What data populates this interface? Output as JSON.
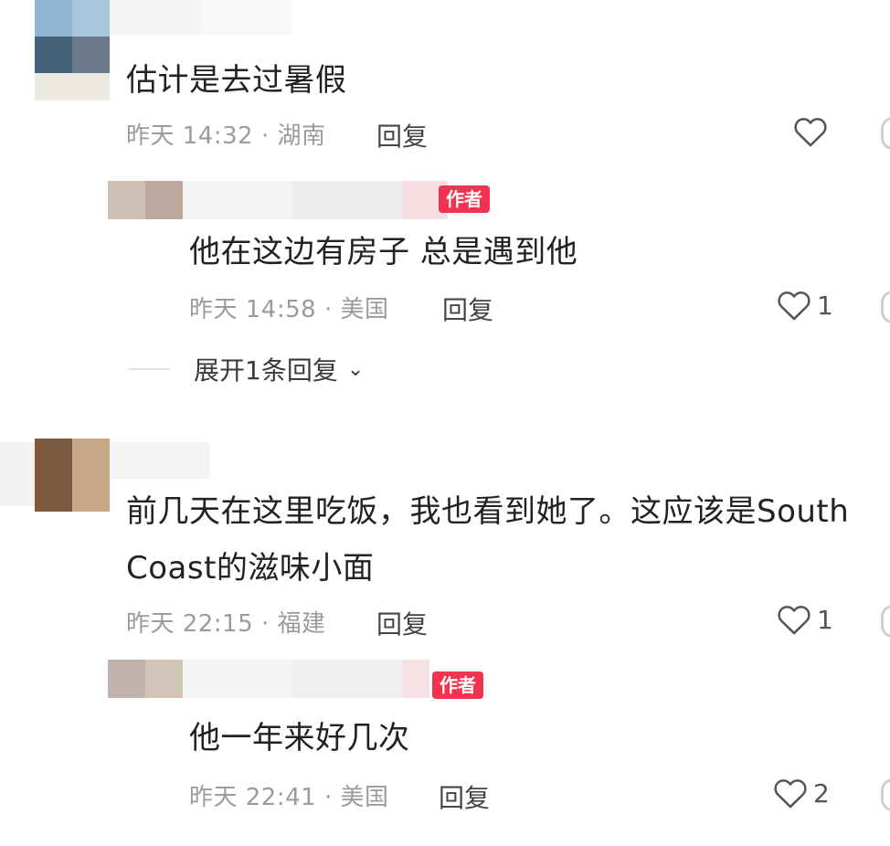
{
  "colors": {
    "author_badge": "#f0344f",
    "meta_text": "#9b9b9b",
    "body_text": "#222222"
  },
  "icons": {
    "like": "heart-outline-icon",
    "expand": "chevron-down-icon"
  },
  "comments": [
    {
      "text": "估计是去过暑假",
      "meta": "昨天 14:32 · 湖南",
      "reply_label": "回复",
      "likes": "",
      "replies": [
        {
          "author_badge": "作者",
          "text": "他在这边有房子 总是遇到他",
          "meta": "昨天 14:58 · 美国",
          "reply_label": "回复",
          "likes": "1"
        }
      ],
      "expand_label": "展开1条回复"
    },
    {
      "text_line1": "前几天在这里吃饭，我也看到她了。这应该是South",
      "text_line2": "Coast的滋味小面",
      "meta": "昨天 22:15 · 福建",
      "reply_label": "回复",
      "likes": "1",
      "replies": [
        {
          "author_badge": "作者",
          "text": "他一年来好几次",
          "meta": "昨天 22:41 · 美国",
          "reply_label": "回复",
          "likes": "2"
        }
      ]
    }
  ]
}
